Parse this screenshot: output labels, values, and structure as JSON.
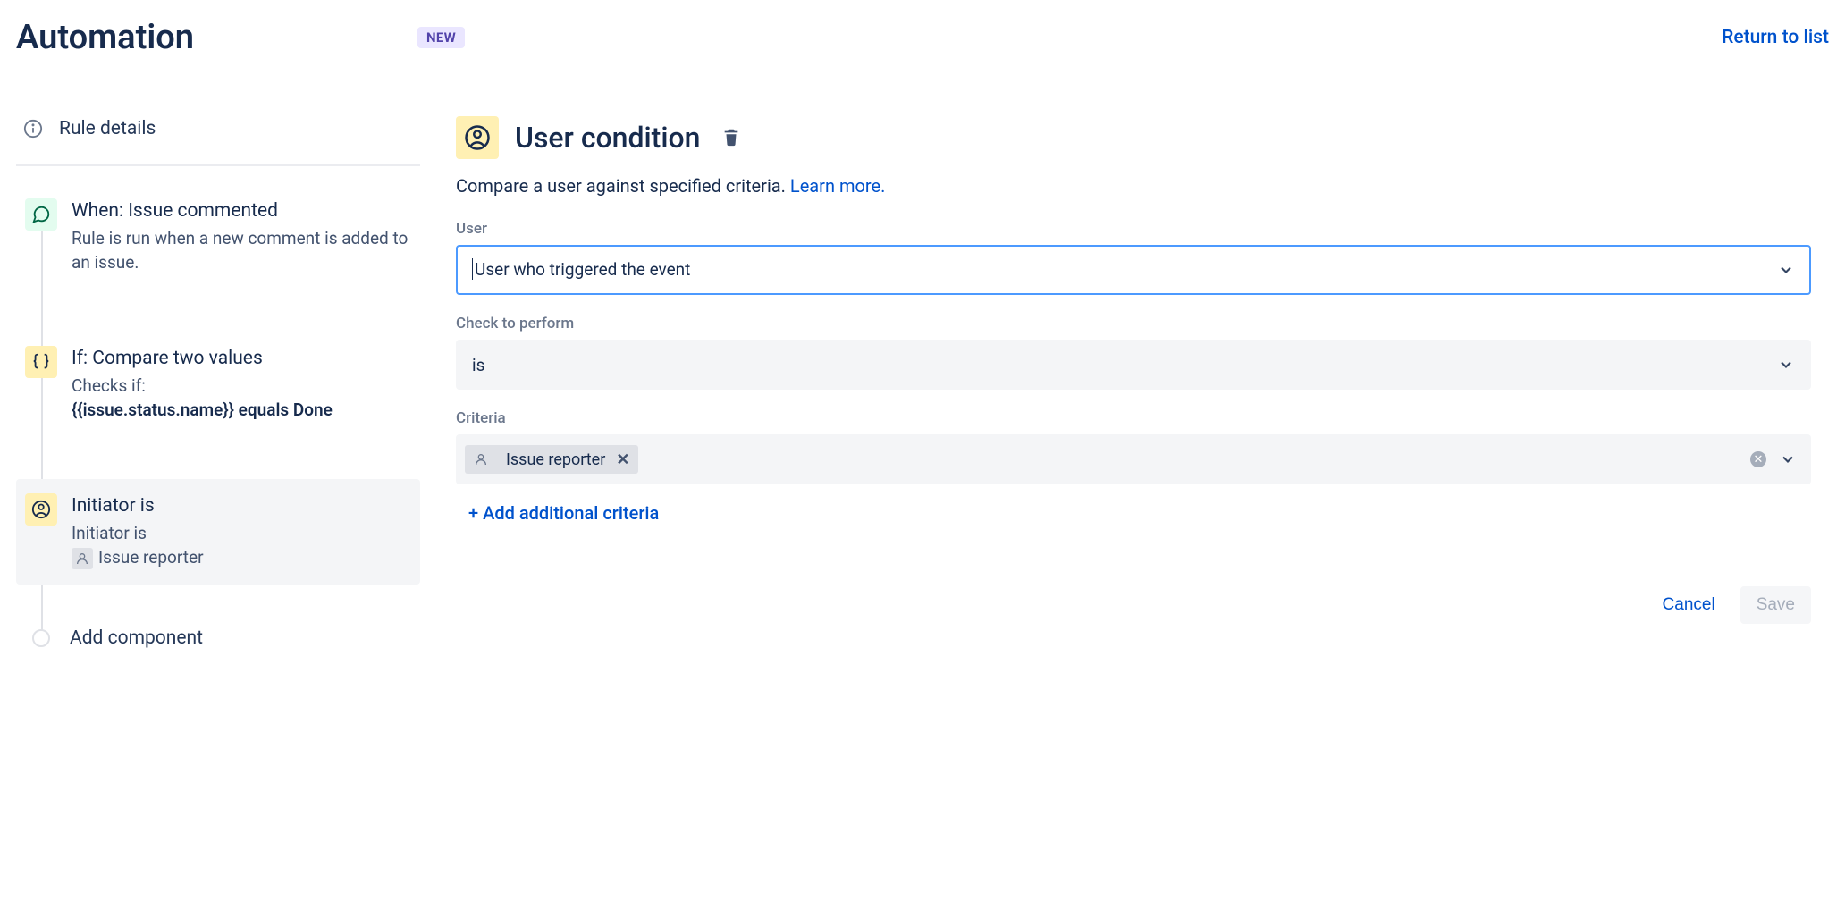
{
  "header": {
    "title": "Automation",
    "badge": "NEW",
    "return_link": "Return to list"
  },
  "sidebar": {
    "rule_details_label": "Rule details",
    "steps": [
      {
        "icon": "comment-icon",
        "icon_bg": "green",
        "title": "When: Issue commented",
        "desc": "Rule is run when a new comment is added to an issue."
      },
      {
        "icon": "braces-icon",
        "icon_bg": "yellow",
        "title": "If: Compare two values",
        "desc_prefix": "Checks if:",
        "desc_bold": "{{issue.status.name}} equals Done"
      },
      {
        "icon": "user-circle-icon",
        "icon_bg": "yellow",
        "title": "Initiator is",
        "desc_prefix": "Initiator is",
        "desc_value": "Issue reporter",
        "selected": true
      }
    ],
    "add_component_label": "Add component"
  },
  "main": {
    "title": "User condition",
    "subtitle_text": "Compare a user against specified criteria. ",
    "learn_more": "Learn more.",
    "fields": {
      "user_label": "User",
      "user_value": "User who triggered the event",
      "check_label": "Check to perform",
      "check_value": "is",
      "criteria_label": "Criteria",
      "criteria_tag": "Issue reporter",
      "add_criteria": "+ Add additional criteria"
    },
    "buttons": {
      "cancel": "Cancel",
      "save": "Save"
    }
  }
}
